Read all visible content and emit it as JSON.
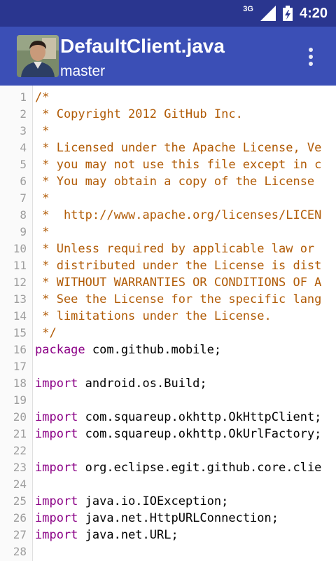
{
  "status_bar": {
    "network": "3G",
    "time": "4:20"
  },
  "app_bar": {
    "title": "DefaultClient.java",
    "subtitle": "master"
  },
  "code_lines": [
    {
      "num": "1",
      "text": "/*",
      "kind": "comment"
    },
    {
      "num": "2",
      "text": " * Copyright 2012 GitHub Inc.",
      "kind": "comment"
    },
    {
      "num": "3",
      "text": " *",
      "kind": "comment"
    },
    {
      "num": "4",
      "text": " * Licensed under the Apache License, Ve",
      "kind": "comment"
    },
    {
      "num": "5",
      "text": " * you may not use this file except in c",
      "kind": "comment"
    },
    {
      "num": "6",
      "text": " * You may obtain a copy of the License",
      "kind": "comment"
    },
    {
      "num": "7",
      "text": " *",
      "kind": "comment"
    },
    {
      "num": "8",
      "text": " *  http://www.apache.org/licenses/LICEN",
      "kind": "comment"
    },
    {
      "num": "9",
      "text": " *",
      "kind": "comment"
    },
    {
      "num": "10",
      "text": " * Unless required by applicable law or",
      "kind": "comment"
    },
    {
      "num": "11",
      "text": " * distributed under the License is dist",
      "kind": "comment"
    },
    {
      "num": "12",
      "text": " * WITHOUT WARRANTIES OR CONDITIONS OF A",
      "kind": "comment"
    },
    {
      "num": "13",
      "text": " * See the License for the specific lang",
      "kind": "comment"
    },
    {
      "num": "14",
      "text": " * limitations under the License.",
      "kind": "comment"
    },
    {
      "num": "15",
      "text": " */",
      "kind": "comment"
    },
    {
      "num": "16",
      "kw": "package",
      "text": " com.github.mobile;",
      "kind": "code"
    },
    {
      "num": "17",
      "text": "",
      "kind": "code"
    },
    {
      "num": "18",
      "kw": "import",
      "text": " android.os.Build;",
      "kind": "code"
    },
    {
      "num": "19",
      "text": "",
      "kind": "code"
    },
    {
      "num": "20",
      "kw": "import",
      "text": " com.squareup.okhttp.OkHttpClient;",
      "kind": "code"
    },
    {
      "num": "21",
      "kw": "import",
      "text": " com.squareup.okhttp.OkUrlFactory;",
      "kind": "code"
    },
    {
      "num": "22",
      "text": "",
      "kind": "code"
    },
    {
      "num": "23",
      "kw": "import",
      "text": " org.eclipse.egit.github.core.clie",
      "kind": "code"
    },
    {
      "num": "24",
      "text": "",
      "kind": "code"
    },
    {
      "num": "25",
      "kw": "import",
      "text": " java.io.IOException;",
      "kind": "code"
    },
    {
      "num": "26",
      "kw": "import",
      "text": " java.net.HttpURLConnection;",
      "kind": "code"
    },
    {
      "num": "27",
      "kw": "import",
      "text": " java.net.URL;",
      "kind": "code"
    },
    {
      "num": "28",
      "text": "",
      "kind": "code"
    }
  ],
  "colors": {
    "status_bar": "#2a368f",
    "app_bar": "#3b4fb6",
    "comment": "#b15b06",
    "keyword": "#8b0086"
  },
  "icons": [
    "signal-icon",
    "battery-icon",
    "overflow-menu-icon",
    "avatar"
  ]
}
